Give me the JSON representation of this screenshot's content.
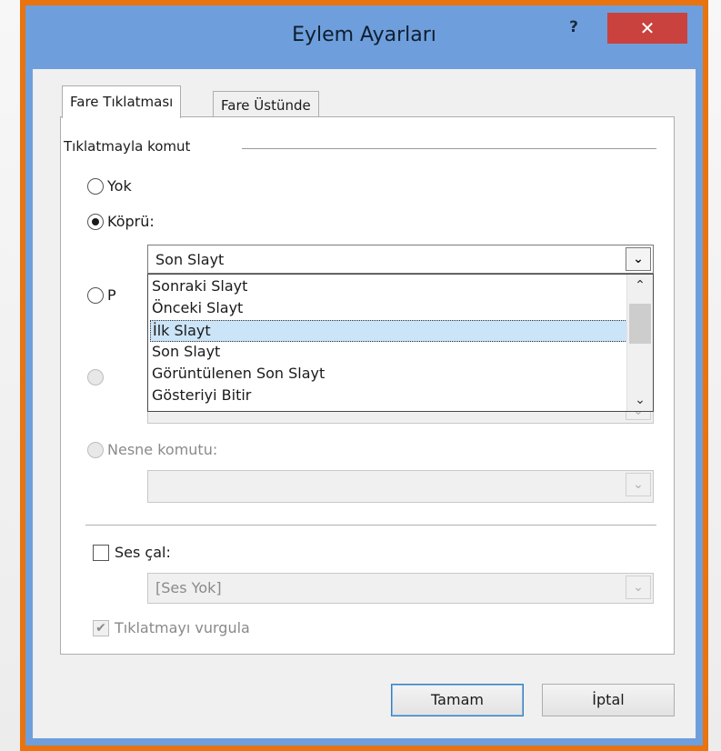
{
  "window": {
    "title": "Eylem Ayarları",
    "help_label": "?",
    "close_label": "✕"
  },
  "tabs": [
    {
      "label": "Fare Tıklatması",
      "active": true
    },
    {
      "label": "Fare Üstünde",
      "active": false
    }
  ],
  "group": {
    "title": "Tıklatmayla komut"
  },
  "options": {
    "none": {
      "label": "Yok",
      "checked": false
    },
    "hyperlink": {
      "label": "Köprü:",
      "checked": true,
      "value": "Son Slayt"
    },
    "run_program": {
      "label": "P",
      "checked": false
    },
    "run_macro": {
      "label": "",
      "checked": false,
      "disabled": true
    },
    "object_action": {
      "label": "Nesne komutu:",
      "disabled": true
    }
  },
  "dropdown": {
    "items": [
      "Sonraki Slayt",
      "Önceki Slayt",
      "İlk Slayt",
      "Son Slayt",
      "Görüntülenen Son Slayt",
      "Gösteriyi Bitir"
    ],
    "selected_index": 2
  },
  "sound": {
    "label": "Ses çal:",
    "checked": false,
    "value": "[Ses Yok]"
  },
  "highlight": {
    "label": "Tıklatmayı vurgula",
    "checked": true,
    "disabled": true
  },
  "buttons": {
    "ok": "Tamam",
    "cancel": "İptal"
  },
  "icons": {
    "dropdown_arrow": "chevron-down-icon",
    "scroll_up": "chevron-up-icon",
    "scroll_down": "chevron-down-icon",
    "check": "check-icon"
  },
  "colors": {
    "frame": "#e8730f",
    "titlebar": "#6e9fdc",
    "close": "#c9423d",
    "selection": "#cce4f7"
  }
}
